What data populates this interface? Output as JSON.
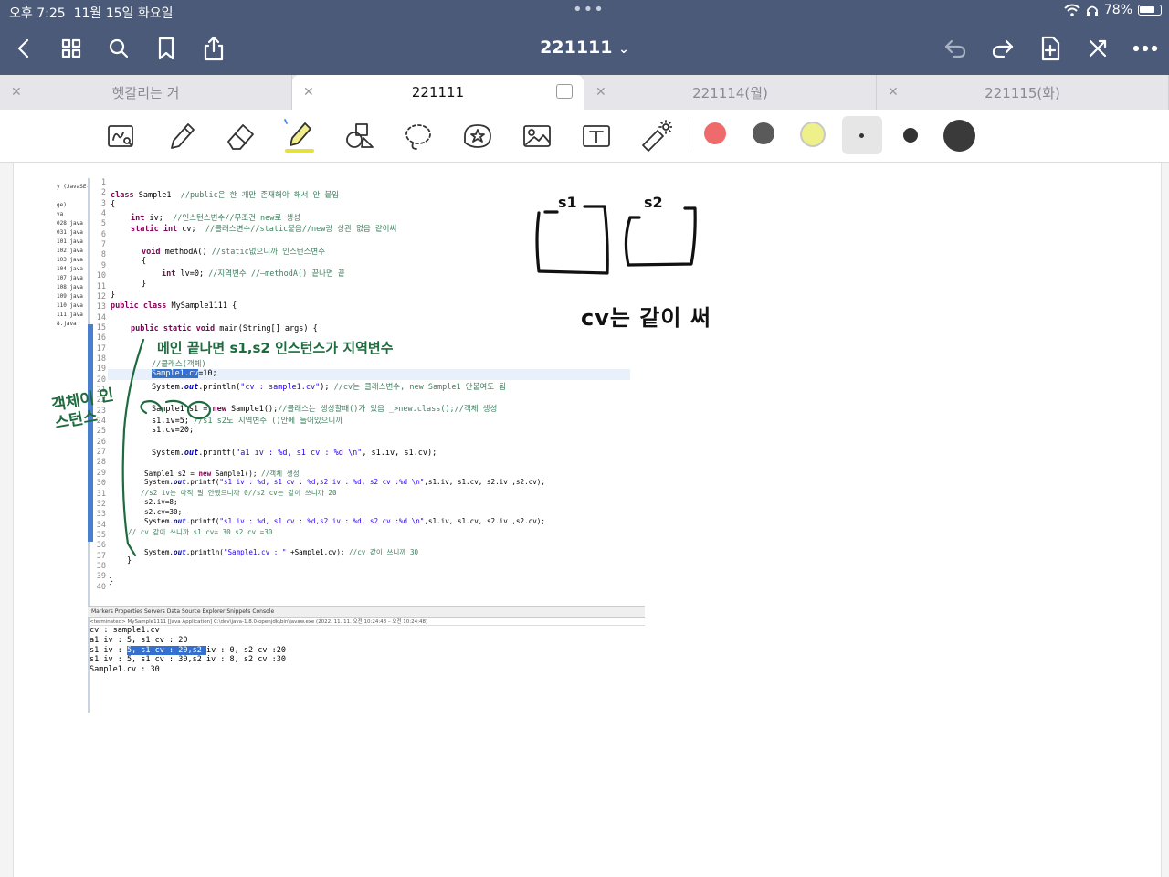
{
  "status_bar": {
    "time": "오후 7:25",
    "date": "11월 15일 화요일",
    "battery": "78%",
    "battery_level": 0.78,
    "multitask_dots": "•••"
  },
  "header": {
    "title": "221111",
    "title_chevron": "⌄",
    "left_icons": [
      "back-icon",
      "grid-icon",
      "search-icon",
      "bookmark-icon",
      "share-icon"
    ],
    "right_icons": [
      "undo-icon",
      "redo-icon",
      "add-page-icon",
      "close-toolbar-icon",
      "more-icon"
    ]
  },
  "tabs": [
    {
      "label": "헷갈리는 거",
      "active": false
    },
    {
      "label": "221111",
      "active": true
    },
    {
      "label": "221114(월)",
      "active": false
    },
    {
      "label": "221115(화)",
      "active": false
    }
  ],
  "toolbar": {
    "tools": [
      "lasso-read-icon",
      "pen-icon",
      "eraser-icon",
      "highlighter-icon",
      "shapes-icon",
      "lasso-icon",
      "sticker-icon",
      "image-icon",
      "text-icon",
      "laser-pointer-icon"
    ],
    "colors": [
      "#ef6b6b",
      "#5a5a5a",
      "#eef08a"
    ],
    "accent": "#4a5a78"
  },
  "eclipse": {
    "files": [
      "y (JavaSE-",
      "",
      "ge)",
      "va",
      "028.java",
      "031.java",
      "101.java",
      "102.java",
      "103.java",
      "104.java",
      "107.java",
      "108.java",
      "109.java",
      "110.java",
      "111.java",
      "8.java"
    ],
    "line_numbers": [
      "1",
      "2",
      "3",
      "4",
      "5",
      "6",
      "7",
      "8",
      "9",
      "10",
      "11",
      "12",
      "13",
      "14",
      "15",
      "16",
      "17",
      "18",
      "19",
      "20",
      "21",
      "22",
      "23",
      "24",
      "25",
      "26",
      "27",
      "28",
      "29",
      "30",
      "31",
      "32",
      "33",
      "34",
      "35",
      "36",
      "37",
      "38",
      "39",
      "40"
    ],
    "code": {
      "l3_a": "class",
      "l3_b": " Sample1  ",
      "l3_c": "//public은 한 개만 존재해야 해서 안 붙임",
      "l4": "{",
      "l5_a": "int",
      "l5_b": " iv;  ",
      "l5_c": "//인스턴스변수//무조건 new로 생성",
      "l6_a": "static int",
      "l6_b": " cv;  ",
      "l6_c": "//클래스변수//static붙음//new랑 상관 없음 같이써",
      "l8_a": "void",
      "l8_b": " methodA() ",
      "l8_c": "//static없으니까 인스턴스변수",
      "l9": "{",
      "l10_a": "int",
      "l10_b": " lv=0; ",
      "l10_c": "//지역변수 //—methodA() 끝나면 끝",
      "l11": "}",
      "l12": "}",
      "l13_a": "public class",
      "l13_b": " MySample1111 {",
      "l15_a": "public static void",
      "l15_b": " main(String[] args) {",
      "l18": "//클래스(객체)",
      "l19_a": "Sample1.cv",
      "l19_b": "=10;",
      "l20_a": "System.",
      "l20_b": "out",
      "l20_c": ".println(",
      "l20_d": "\"cv : sample1.cv\"",
      "l20_e": "); ",
      "l20_f": "//cv는 클래스변수, new Sample1 안붙여도 됨",
      "l22_a": "Sample1 s1 = ",
      "l22_b": "new",
      "l22_c": " Sample1();",
      "l22_d": "//클래스는 생성할때()가 있음 _>new.class();//객체 생성",
      "l23_a": "s1.iv=5; ",
      "l23_b": "//s1 s2도 지역변수 ()안에 들어있으니까",
      "l24": "s1.cv=20;",
      "l26_a": "System.",
      "l26_b": "out",
      "l26_c": ".printf(",
      "l26_d": "\"a1 iv : %d, s1 cv : %d \\n\"",
      "l26_e": ", s1.iv, s1.cv);",
      "l28_a": "Sample1 s2 = ",
      "l28_b": "new",
      "l28_c": " Sample1(); ",
      "l28_d": "//객체 생성",
      "l29_a": "System.",
      "l29_b": "out",
      "l29_c": ".printf(",
      "l29_d": "\"s1 iv : %d, s1 cv : %d,s2 iv : %d, s2 cv :%d \\n\"",
      "l29_e": ",s1.iv, s1.cv, s2.iv ,s2.cv);",
      "l30": "//s2 iv는 아직 말 안했으니까 0//s2 cv는 같이 쓰니까 20",
      "l31": "s2.iv=8;",
      "l32": "s2.cv=30;",
      "l33_a": "System.",
      "l33_b": "out",
      "l33_c": ".printf(",
      "l33_d": "\"s1 iv : %d, s1 cv : %d,s2 iv : %d, s2 cv :%d \\n\"",
      "l33_e": ",s1.iv, s1.cv, s2.iv ,s2.cv);",
      "l34": "// cv 같이 쓰니까 s1 cv= 30 s2 cv =30",
      "l36_a": "System.",
      "l36_b": "out",
      "l36_c": ".println(",
      "l36_d": "\"Sample1.cv : \"",
      "l36_e": " +Sample1.cv); ",
      "l36_f": "//cv 같이 쓰니까 30",
      "l37": "}",
      "l39": "}"
    },
    "console_tabs": "Markers   Properties   Servers   Data Source Explorer   Snippets   Console",
    "console_path": "<terminated> MySample1111 [Java Application] C:\\dev\\java-1.8.0-openjdk\\bin\\javaw.exe  (2022. 11. 11. 오전 10:24:48 – 오전 10:24:48)",
    "console_lines": {
      "c1": "cv : sample1.cv",
      "c2": "a1 iv : 5, s1 cv : 20",
      "c3_a": "s1 iv : ",
      "c3_b": "5, s1 cv : 20,s2 ",
      "c3_c": "iv : 0, s2 cv :20",
      "c4": "s1 iv : 5, s1 cv : 30,s2 iv : 8, s2 cv :30",
      "c5": "Sample1.cv : 30"
    }
  },
  "handwriting": {
    "note_top": "메인 끝나면 s1,s2 인스턴스가 지역변수",
    "note_side": "객체이 인스턴스",
    "label_s1": "s1",
    "label_s2": "s2",
    "cv_note": "cv는 같이 써",
    "ink_green": "#1d6b3e"
  }
}
